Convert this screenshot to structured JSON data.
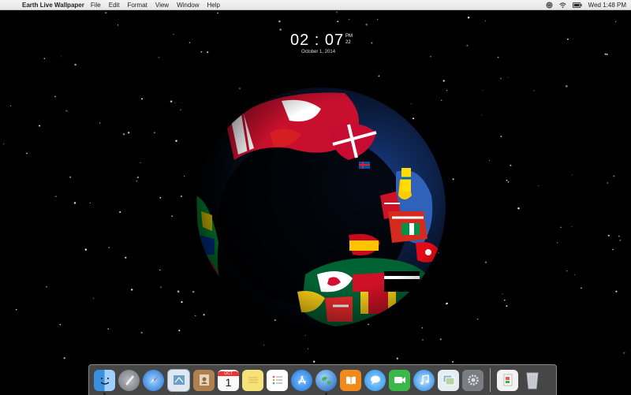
{
  "menubar": {
    "app_name": "Earth Live Wallpaper",
    "menus": [
      "File",
      "Edit",
      "Format",
      "View",
      "Window",
      "Help"
    ],
    "clock": "Wed 1:48 PM"
  },
  "clock": {
    "time": "02 : 07",
    "ampm": "PM",
    "seconds": "22",
    "date": "October 1, 2014"
  },
  "dock": {
    "apps": [
      {
        "name": "Finder",
        "icon": "finder-icon",
        "color": "#3b8fe0"
      },
      {
        "name": "Launchpad",
        "icon": "rocket-icon",
        "color": "#8a8f99"
      },
      {
        "name": "Safari",
        "icon": "compass-icon",
        "color": "#2f7fd8"
      },
      {
        "name": "Mail",
        "icon": "stamp-icon",
        "color": "#7fa8c9"
      },
      {
        "name": "Contacts",
        "icon": "contacts-icon",
        "color": "#a77c4b"
      },
      {
        "name": "Calendar",
        "icon": "calendar-icon",
        "color": "#f4f4f4"
      },
      {
        "name": "Notes",
        "icon": "notes-icon",
        "color": "#f7e27a"
      },
      {
        "name": "Reminders",
        "icon": "reminders-icon",
        "color": "#f2f2f2"
      },
      {
        "name": "App Store",
        "icon": "app-store-icon",
        "color": "#2f8ef0"
      },
      {
        "name": "Earth Live Wallpaper",
        "icon": "globe-icon",
        "color": "#3a7bd0"
      },
      {
        "name": "iBooks",
        "icon": "book-icon",
        "color": "#f08a1a"
      },
      {
        "name": "Messages",
        "icon": "speech-bubble-icon",
        "color": "#3aa6f0"
      },
      {
        "name": "FaceTime",
        "icon": "facetime-icon",
        "color": "#3bb84a"
      },
      {
        "name": "iTunes",
        "icon": "music-icon",
        "color": "#1f8fe0"
      },
      {
        "name": "Preview",
        "icon": "preview-icon",
        "color": "#8fb8d8"
      },
      {
        "name": "System Preferences",
        "icon": "gear-icon",
        "color": "#7a7d83"
      }
    ],
    "calendar_month": "OCT",
    "calendar_day": "1",
    "right": [
      {
        "name": "Downloads",
        "icon": "downloads-stack-icon",
        "color": "#e8e8e8"
      },
      {
        "name": "Trash",
        "icon": "trash-icon",
        "color": "#cfd3d7"
      }
    ]
  }
}
